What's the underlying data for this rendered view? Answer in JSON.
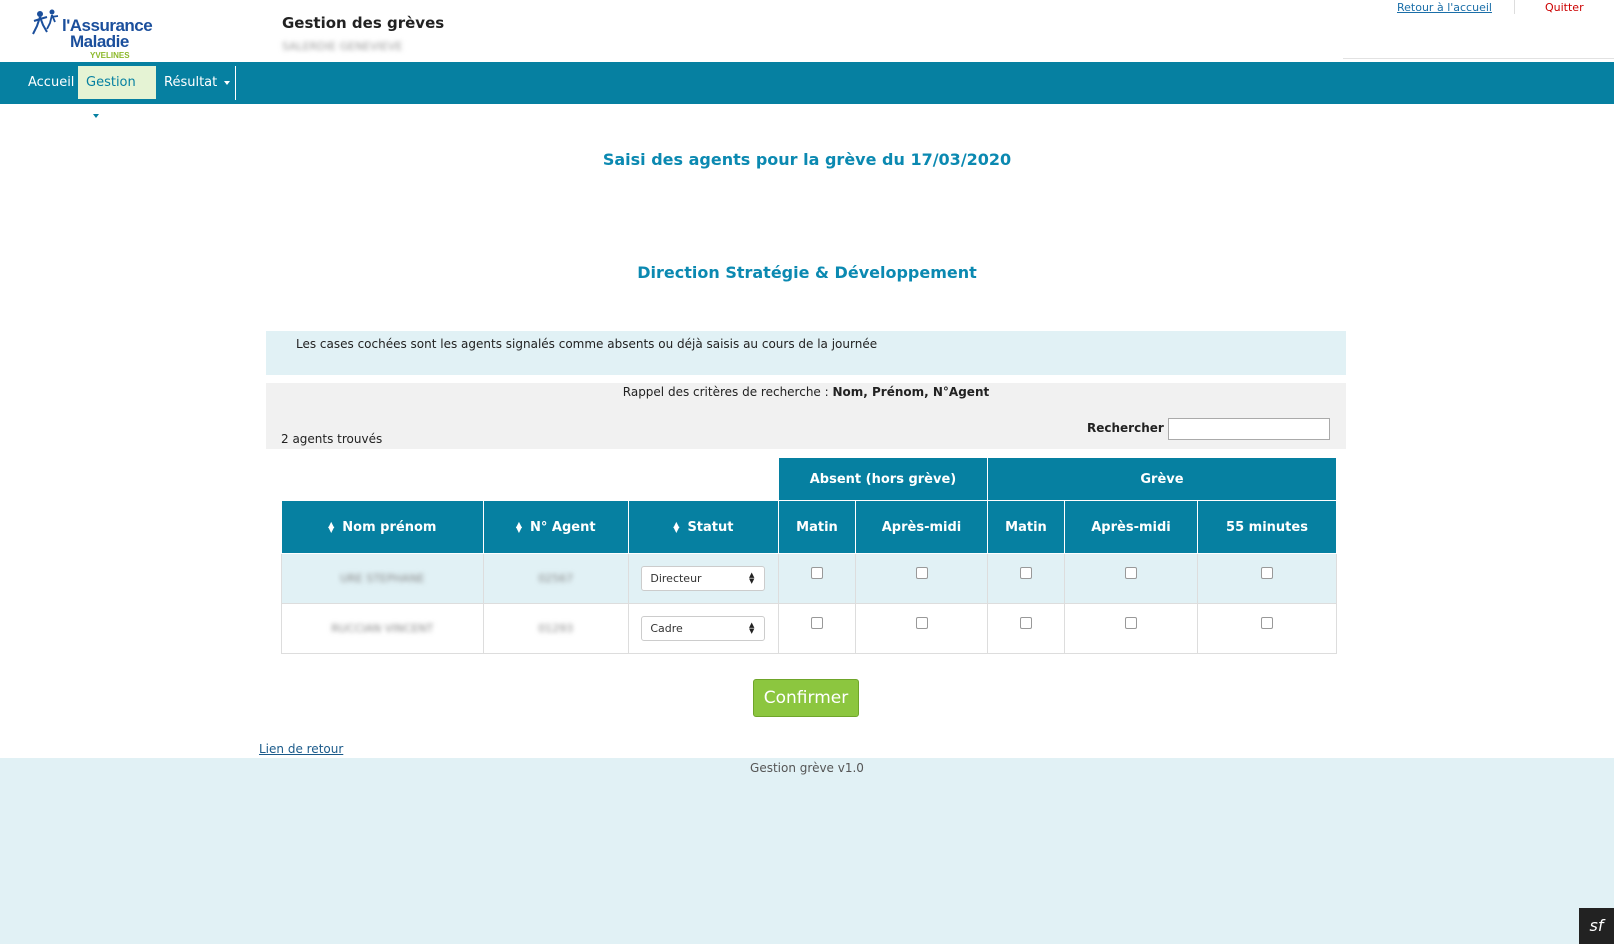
{
  "header": {
    "logo_line1": "l'Assurance",
    "logo_line2": "Maladie",
    "logo_line3": "YVELINES",
    "app_title": "Gestion des grèves",
    "user_name": "SALERDIE GENEVIEVE",
    "home_link": "Retour à l'accueil",
    "quit_link": "Quitter"
  },
  "nav": {
    "accueil": "Accueil",
    "gestion": "Gestion",
    "resultat": "Résultat"
  },
  "main": {
    "page_title": "Saisi des agents pour la grève du 17/03/2020",
    "section_title": "Direction Stratégie & Développement",
    "info_text": "Les cases cochées sont les agents signalés comme absents ou déjà saisis au cours de la journée",
    "criteria_prefix": "Rappel des critères de recherche : ",
    "criteria_values": "Nom, Prénom, N°Agent",
    "count_text": "2 agents trouvés",
    "search_label": "Rechercher",
    "search_value": ""
  },
  "table": {
    "group_absent": "Absent (hors grève)",
    "group_greve": "Grève",
    "col_nom": "Nom prénom",
    "col_agent": "N° Agent",
    "col_statut": "Statut",
    "col_matin": "Matin",
    "col_apres_midi": "Après-midi",
    "col_matin2": "Matin",
    "col_apres_midi2": "Après-midi",
    "col_55": "55 minutes",
    "rows": [
      {
        "nom": "URE STEPHANE",
        "agent": "02567",
        "statut": "Directeur"
      },
      {
        "nom": "RUCCIAN VINCENT",
        "agent": "01293",
        "statut": "Cadre"
      }
    ]
  },
  "confirm_label": "Confirmer",
  "back_link": "Lien de retour",
  "footer_text": "Gestion grève v1.0",
  "colors": {
    "nav_bg": "#0680a1",
    "accent_title": "#0b89b1",
    "confirm_bg": "#8cc63f",
    "info_bg": "#e1f1f5"
  }
}
